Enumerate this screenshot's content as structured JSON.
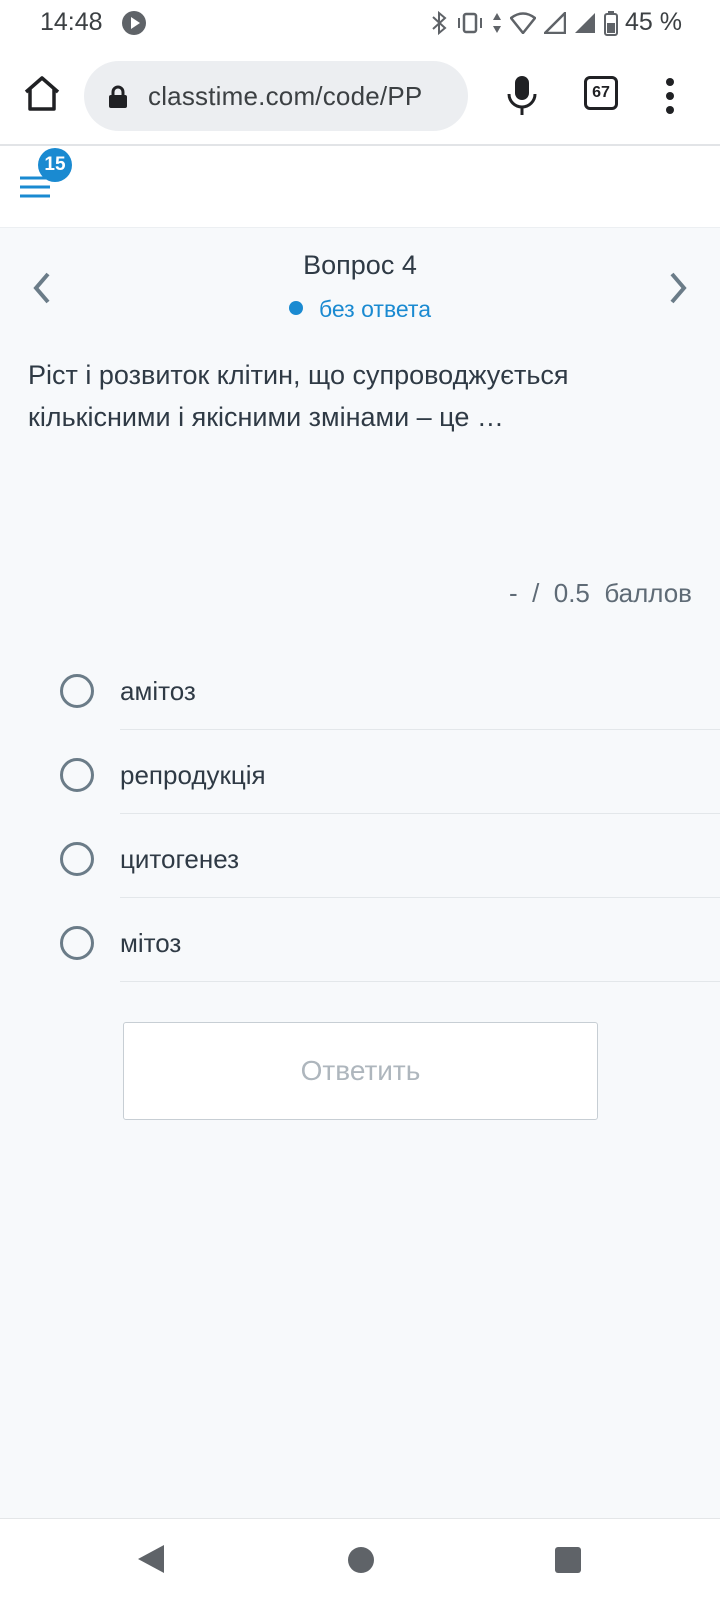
{
  "status_bar": {
    "time": "14:48",
    "battery": "45 %",
    "icons": [
      "play-icon",
      "bluetooth-icon",
      "vibrate-icon",
      "wifi-icon",
      "signal-icon",
      "battery-icon"
    ]
  },
  "browser": {
    "url": "classtime.com/code/PP",
    "tab_count": "67"
  },
  "header": {
    "notification_count": "15"
  },
  "question": {
    "title": "Вопрос 4",
    "status": "без ответа",
    "text": "Ріст і розвиток клітин, що супроводжується кількісними і якісними змінами – це …",
    "points": "-  /  0.5  баллов"
  },
  "options": [
    {
      "label": "амітоз"
    },
    {
      "label": "репродукція"
    },
    {
      "label": "цитогенез"
    },
    {
      "label": "мітоз"
    }
  ],
  "submit_label": "Ответить",
  "colors": {
    "accent": "#1a8ad1",
    "text": "#2f3a45",
    "background": "#f7f9fb"
  }
}
